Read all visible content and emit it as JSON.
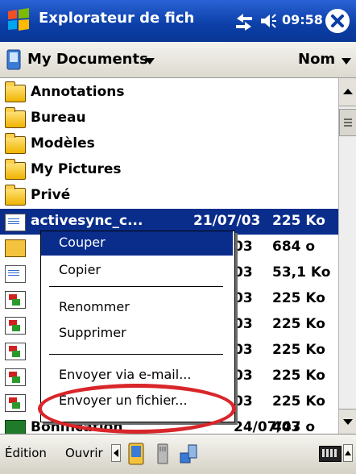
{
  "titlebar": {
    "title": "Explorateur de fich",
    "clock": "09:58"
  },
  "location": {
    "folder": "My Documents",
    "sort": "Nom"
  },
  "folders": [
    {
      "name": "Annotations"
    },
    {
      "name": "Bureau"
    },
    {
      "name": "Modèles"
    },
    {
      "name": "My Pictures"
    },
    {
      "name": "Privé"
    }
  ],
  "files": [
    {
      "name": "activesync_c...",
      "date": "21/07/03",
      "size": "225 Ko",
      "icon": "activesync-icon"
    },
    {
      "name": "",
      "date": "03",
      "size": "684 o",
      "icon": "pda-file-icon"
    },
    {
      "name": "",
      "date": "03",
      "size": "53,1 Ko",
      "icon": "word-doc-icon"
    },
    {
      "name": "",
      "date": "03",
      "size": "225 Ko",
      "icon": "note-icon"
    },
    {
      "name": "",
      "date": "03",
      "size": "225 Ko",
      "icon": "note-icon"
    },
    {
      "name": "",
      "date": "03",
      "size": "225 Ko",
      "icon": "note-icon"
    },
    {
      "name": "",
      "date": "03",
      "size": "225 Ko",
      "icon": "note-icon"
    },
    {
      "name": "",
      "date": "03",
      "size": "225 Ko",
      "icon": "note-icon"
    },
    {
      "name": "Bonification",
      "date": "24/07/03",
      "size": "447 o",
      "icon": "excel-icon"
    }
  ],
  "context_menu": {
    "cut": "Couper",
    "copy": "Copier",
    "rename": "Renommer",
    "delete": "Supprimer",
    "email": "Envoyer via e-mail...",
    "send_file": "Envoyer un fichier..."
  },
  "bottombar": {
    "edit": "Édition",
    "open": "Ouvrir"
  },
  "colors": {
    "titlebar": "#0b3ea6",
    "selection": "#0a2d8c",
    "annotation": "#d9262a"
  }
}
